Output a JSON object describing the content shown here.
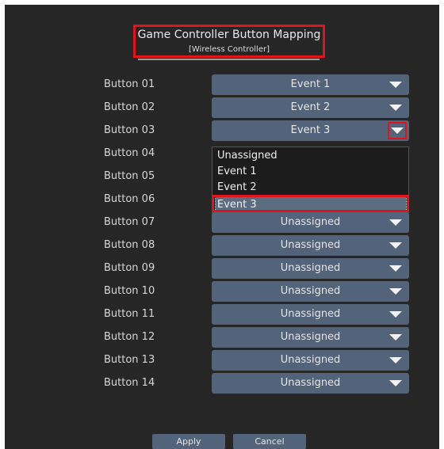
{
  "header": {
    "title": "Game Controller Button Mapping",
    "subtitle": "[Wireless Controller]"
  },
  "rows": [
    {
      "label": "Button 01",
      "value": "Event 1"
    },
    {
      "label": "Button 02",
      "value": "Event 2"
    },
    {
      "label": "Button 03",
      "value": "Event 3"
    },
    {
      "label": "Button 04",
      "value": ""
    },
    {
      "label": "Button 05",
      "value": ""
    },
    {
      "label": "Button 06",
      "value": ""
    },
    {
      "label": "Button 07",
      "value": "Unassigned"
    },
    {
      "label": "Button 08",
      "value": "Unassigned"
    },
    {
      "label": "Button 09",
      "value": "Unassigned"
    },
    {
      "label": "Button 10",
      "value": "Unassigned"
    },
    {
      "label": "Button 11",
      "value": "Unassigned"
    },
    {
      "label": "Button 12",
      "value": "Unassigned"
    },
    {
      "label": "Button 13",
      "value": "Unassigned"
    },
    {
      "label": "Button 14",
      "value": "Unassigned"
    }
  ],
  "dropdown": {
    "options": [
      "Unassigned",
      "Event 1",
      "Event 2",
      "Event 3"
    ],
    "selected": "Event 3"
  },
  "footer": {
    "apply_label": "Apply",
    "cancel_label": "Cancel"
  },
  "colors": {
    "background": "#262626",
    "select": "#53637a",
    "highlight": "#e0141c"
  }
}
